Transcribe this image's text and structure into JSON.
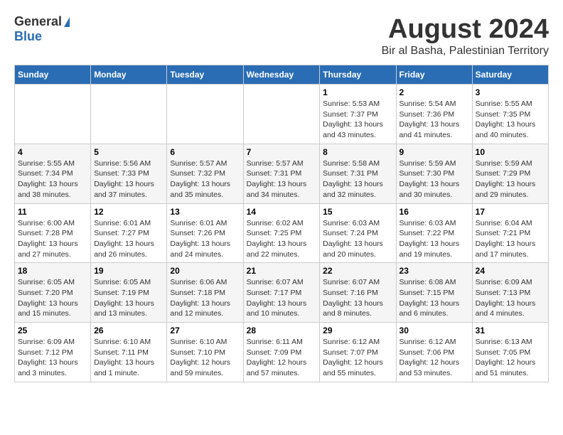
{
  "header": {
    "logo_general": "General",
    "logo_blue": "Blue",
    "month_title": "August 2024",
    "location": "Bir al Basha, Palestinian Territory"
  },
  "days_of_week": [
    "Sunday",
    "Monday",
    "Tuesday",
    "Wednesday",
    "Thursday",
    "Friday",
    "Saturday"
  ],
  "weeks": [
    [
      {
        "day": "",
        "info": ""
      },
      {
        "day": "",
        "info": ""
      },
      {
        "day": "",
        "info": ""
      },
      {
        "day": "",
        "info": ""
      },
      {
        "day": "1",
        "info": "Sunrise: 5:53 AM\nSunset: 7:37 PM\nDaylight: 13 hours\nand 43 minutes."
      },
      {
        "day": "2",
        "info": "Sunrise: 5:54 AM\nSunset: 7:36 PM\nDaylight: 13 hours\nand 41 minutes."
      },
      {
        "day": "3",
        "info": "Sunrise: 5:55 AM\nSunset: 7:35 PM\nDaylight: 13 hours\nand 40 minutes."
      }
    ],
    [
      {
        "day": "4",
        "info": "Sunrise: 5:55 AM\nSunset: 7:34 PM\nDaylight: 13 hours\nand 38 minutes."
      },
      {
        "day": "5",
        "info": "Sunrise: 5:56 AM\nSunset: 7:33 PM\nDaylight: 13 hours\nand 37 minutes."
      },
      {
        "day": "6",
        "info": "Sunrise: 5:57 AM\nSunset: 7:32 PM\nDaylight: 13 hours\nand 35 minutes."
      },
      {
        "day": "7",
        "info": "Sunrise: 5:57 AM\nSunset: 7:31 PM\nDaylight: 13 hours\nand 34 minutes."
      },
      {
        "day": "8",
        "info": "Sunrise: 5:58 AM\nSunset: 7:31 PM\nDaylight: 13 hours\nand 32 minutes."
      },
      {
        "day": "9",
        "info": "Sunrise: 5:59 AM\nSunset: 7:30 PM\nDaylight: 13 hours\nand 30 minutes."
      },
      {
        "day": "10",
        "info": "Sunrise: 5:59 AM\nSunset: 7:29 PM\nDaylight: 13 hours\nand 29 minutes."
      }
    ],
    [
      {
        "day": "11",
        "info": "Sunrise: 6:00 AM\nSunset: 7:28 PM\nDaylight: 13 hours\nand 27 minutes."
      },
      {
        "day": "12",
        "info": "Sunrise: 6:01 AM\nSunset: 7:27 PM\nDaylight: 13 hours\nand 26 minutes."
      },
      {
        "day": "13",
        "info": "Sunrise: 6:01 AM\nSunset: 7:26 PM\nDaylight: 13 hours\nand 24 minutes."
      },
      {
        "day": "14",
        "info": "Sunrise: 6:02 AM\nSunset: 7:25 PM\nDaylight: 13 hours\nand 22 minutes."
      },
      {
        "day": "15",
        "info": "Sunrise: 6:03 AM\nSunset: 7:24 PM\nDaylight: 13 hours\nand 20 minutes."
      },
      {
        "day": "16",
        "info": "Sunrise: 6:03 AM\nSunset: 7:22 PM\nDaylight: 13 hours\nand 19 minutes."
      },
      {
        "day": "17",
        "info": "Sunrise: 6:04 AM\nSunset: 7:21 PM\nDaylight: 13 hours\nand 17 minutes."
      }
    ],
    [
      {
        "day": "18",
        "info": "Sunrise: 6:05 AM\nSunset: 7:20 PM\nDaylight: 13 hours\nand 15 minutes."
      },
      {
        "day": "19",
        "info": "Sunrise: 6:05 AM\nSunset: 7:19 PM\nDaylight: 13 hours\nand 13 minutes."
      },
      {
        "day": "20",
        "info": "Sunrise: 6:06 AM\nSunset: 7:18 PM\nDaylight: 13 hours\nand 12 minutes."
      },
      {
        "day": "21",
        "info": "Sunrise: 6:07 AM\nSunset: 7:17 PM\nDaylight: 13 hours\nand 10 minutes."
      },
      {
        "day": "22",
        "info": "Sunrise: 6:07 AM\nSunset: 7:16 PM\nDaylight: 13 hours\nand 8 minutes."
      },
      {
        "day": "23",
        "info": "Sunrise: 6:08 AM\nSunset: 7:15 PM\nDaylight: 13 hours\nand 6 minutes."
      },
      {
        "day": "24",
        "info": "Sunrise: 6:09 AM\nSunset: 7:13 PM\nDaylight: 13 hours\nand 4 minutes."
      }
    ],
    [
      {
        "day": "25",
        "info": "Sunrise: 6:09 AM\nSunset: 7:12 PM\nDaylight: 13 hours\nand 3 minutes."
      },
      {
        "day": "26",
        "info": "Sunrise: 6:10 AM\nSunset: 7:11 PM\nDaylight: 13 hours\nand 1 minute."
      },
      {
        "day": "27",
        "info": "Sunrise: 6:10 AM\nSunset: 7:10 PM\nDaylight: 12 hours\nand 59 minutes."
      },
      {
        "day": "28",
        "info": "Sunrise: 6:11 AM\nSunset: 7:09 PM\nDaylight: 12 hours\nand 57 minutes."
      },
      {
        "day": "29",
        "info": "Sunrise: 6:12 AM\nSunset: 7:07 PM\nDaylight: 12 hours\nand 55 minutes."
      },
      {
        "day": "30",
        "info": "Sunrise: 6:12 AM\nSunset: 7:06 PM\nDaylight: 12 hours\nand 53 minutes."
      },
      {
        "day": "31",
        "info": "Sunrise: 6:13 AM\nSunset: 7:05 PM\nDaylight: 12 hours\nand 51 minutes."
      }
    ]
  ]
}
